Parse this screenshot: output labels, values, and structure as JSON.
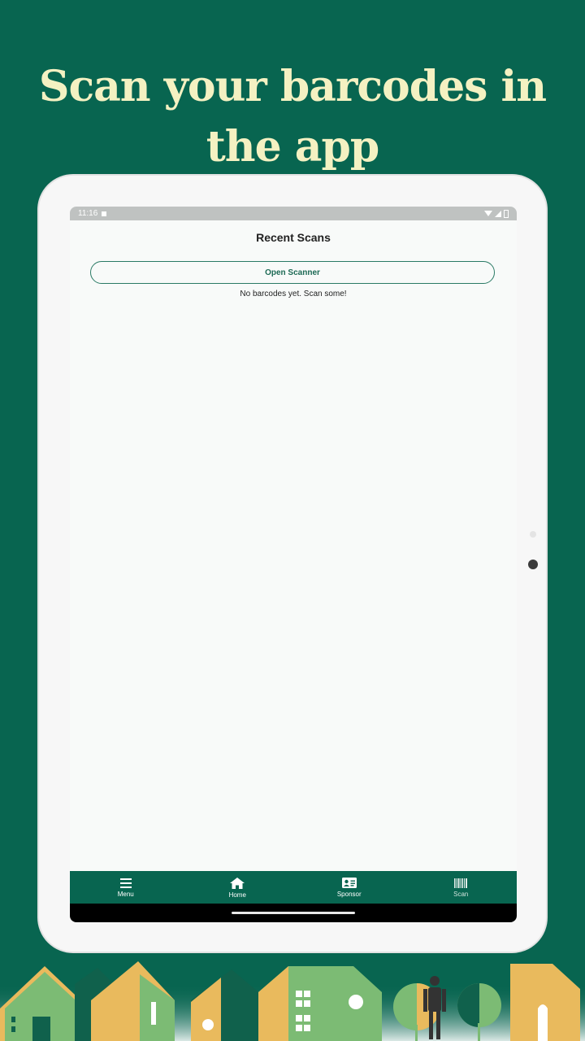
{
  "promo": {
    "headline_line1": "Scan your barcodes in",
    "headline_line2": "the app"
  },
  "status_bar": {
    "time": "11:16"
  },
  "screen": {
    "title": "Recent Scans",
    "open_scanner_label": "Open Scanner",
    "empty_message": "No barcodes yet. Scan some!"
  },
  "bottom_nav": {
    "items": [
      {
        "label": "Menu",
        "icon": "menu-icon"
      },
      {
        "label": "Home",
        "icon": "home-icon"
      },
      {
        "label": "Sponsor",
        "icon": "id-card-icon"
      },
      {
        "label": "Scan",
        "icon": "barcode-icon"
      }
    ]
  },
  "colors": {
    "background": "#086550",
    "headline": "#f4f1c2",
    "nav": "#086550",
    "house_green": "#7cbb74",
    "house_yellow": "#e9ba5d"
  }
}
